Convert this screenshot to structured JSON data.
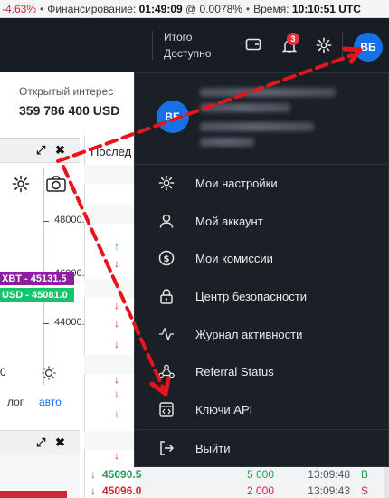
{
  "ticker": {
    "change": "-4.63%",
    "funding_label": "Финансирование:",
    "funding_time": "01:49:09",
    "funding_rate": "@ 0.0078%",
    "time_label": "Время:",
    "time_value": "10:10:51 UTC"
  },
  "header": {
    "summary_line1": "Итого",
    "summary_line2": "Доступно",
    "notification_count": "3",
    "avatar_initials": "ВБ"
  },
  "background": {
    "open_interest_label": "Открытый интерес",
    "open_interest_value": "359 786 400 USD",
    "trades_header": "Послед",
    "close_symbol": "✖",
    "expand_symbol": "⤢",
    "chart": {
      "ticks": [
        "48000.0",
        "44000.0",
        "46000.0"
      ],
      "tag_xbt": "XBT - 45131.5",
      "tag_usd": "USD - 45081.0",
      "zero_label": "0",
      "log_label": "лог",
      "auto_label": "авто"
    },
    "trades": [
      {
        "arrow": "↓",
        "dir": "down",
        "price": "45090.5",
        "qty": "5 000",
        "time": "13:09:48",
        "side": "B"
      },
      {
        "arrow": "↓",
        "dir": "down",
        "price": "45096.0",
        "qty": "2 000",
        "time": "13:09:43",
        "side": "S"
      }
    ],
    "last_row_arrow": "↓"
  },
  "menu": {
    "avatar_initials": "ВБ",
    "items": [
      {
        "label": "Мои настройки",
        "icon": "gear-icon"
      },
      {
        "label": "Мой аккаунт",
        "icon": "user-icon"
      },
      {
        "label": "Мои комиссии",
        "icon": "dollar-circle-icon"
      },
      {
        "label": "Центр безопасности",
        "icon": "lock-icon"
      },
      {
        "label": "Журнал активности",
        "icon": "activity-icon"
      },
      {
        "label": "Referral Status",
        "icon": "referral-icon"
      },
      {
        "label": "Ключи API",
        "icon": "api-key-icon"
      },
      {
        "label": "Выйти",
        "icon": "logout-icon"
      }
    ]
  },
  "colors": {
    "header_bg": "#181d24",
    "menu_bg": "#1b2027",
    "avatar_blue": "#1670e6",
    "badge_red": "#e5343d",
    "buy_green": "#1e9e55",
    "sell_red": "#d0263a",
    "tag_purple": "#8b1fa0",
    "tag_green": "#17c46b",
    "annotation_red": "#e8141c"
  }
}
